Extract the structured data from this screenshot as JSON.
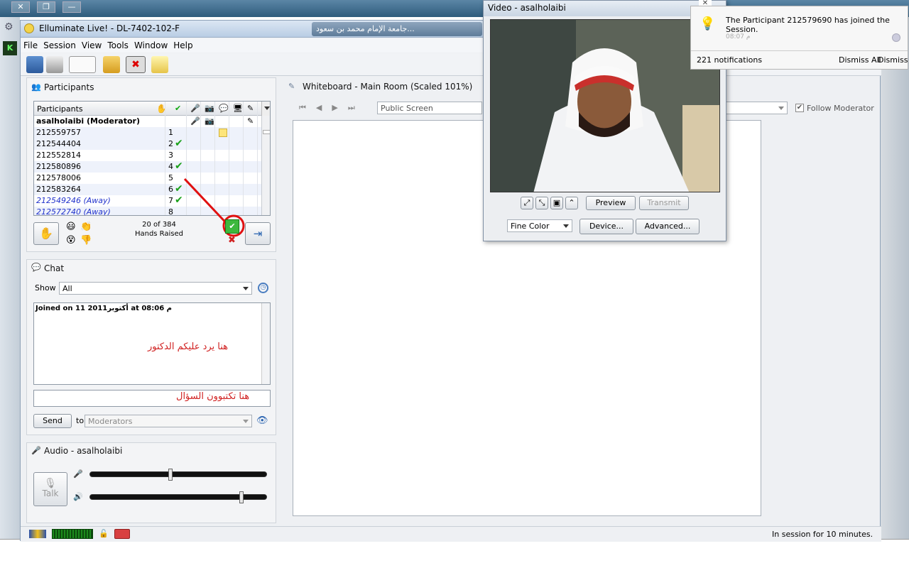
{
  "window": {
    "title": "Elluminate Live! - DL-7402-102-F",
    "tab_text": "جامعة الإمام محمد بن سعود..."
  },
  "menu": [
    "File",
    "Session",
    "View",
    "Tools",
    "Window",
    "Help"
  ],
  "participants": {
    "header": "Participants",
    "column_title": "Participants",
    "moderator": "asalholaibi (Moderator)",
    "rows": [
      {
        "name": "212559757",
        "num": "1",
        "check": ""
      },
      {
        "name": "212544404",
        "num": "2",
        "check": "✔"
      },
      {
        "name": "212552814",
        "num": "3",
        "check": ""
      },
      {
        "name": "212580896",
        "num": "4",
        "check": "✔"
      },
      {
        "name": "212578006",
        "num": "5",
        "check": ""
      },
      {
        "name": "212583264",
        "num": "6",
        "check": "✔"
      },
      {
        "name": "212549246 (Away)",
        "num": "7",
        "check": "✔"
      },
      {
        "name": "212572740 (Away)",
        "num": "8",
        "check": ""
      }
    ],
    "hands_count": "20 of 384",
    "hands_label": "Hands Raised"
  },
  "chat": {
    "header": "Chat",
    "show_label": "Show",
    "show_value": "All",
    "joined_text": "Joined on 11 أكتوبر2011 at 08:06 م",
    "annotation_reply": "هنا يرد عليكم الدكتور",
    "annotation_question": "هنا تكتبوون السؤال",
    "send_label": "Send",
    "to_label": "to",
    "to_value": "Moderators"
  },
  "audio": {
    "header": "Audio - asalholaibi",
    "talk_label": "Talk",
    "mic_level": 0.45,
    "speaker_level": 0.86
  },
  "whiteboard": {
    "header": "Whiteboard - Main Room (Scaled 101%)",
    "screen": "Public Screen",
    "follow_label": "Follow Moderator",
    "follow_checked": true
  },
  "video": {
    "title": "Video - asalholaibi",
    "preview_label": "Preview",
    "transmit_label": "Transmit",
    "color_value": "Fine Color",
    "device_label": "Device...",
    "advanced_label": "Advanced..."
  },
  "notification": {
    "message": "The Participant 212579690 has joined the Session.",
    "time": "08:07 م",
    "count": "221 notifications",
    "dismiss_all": "Dismiss All",
    "dismiss": "Dismiss"
  },
  "status": {
    "text": "In session for 10 minutes."
  }
}
